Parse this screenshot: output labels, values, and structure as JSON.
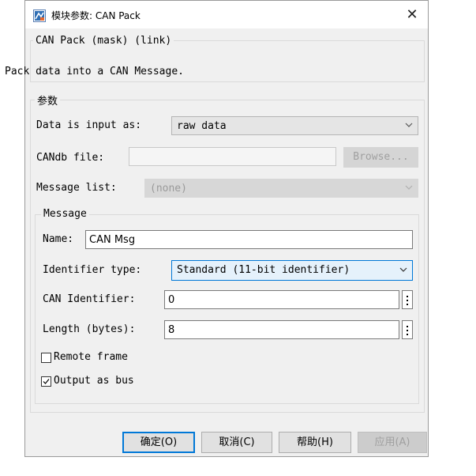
{
  "window": {
    "title": "模块参数: CAN Pack",
    "close_glyph": "✕"
  },
  "description": {
    "group_title": "CAN Pack (mask) (link)",
    "text": "Pack data into a CAN Message."
  },
  "params": {
    "group_title": "参数",
    "data_input": {
      "label": "Data is input as:",
      "value": "raw data"
    },
    "candb": {
      "label": "CANdb file:",
      "value": "",
      "browse_label": "Browse..."
    },
    "message_list": {
      "label": "Message list:",
      "value": "(none)"
    }
  },
  "message": {
    "group_title": "Message",
    "name": {
      "label": "Name:",
      "value": "CAN Msg"
    },
    "identifier_type": {
      "label": "Identifier type:",
      "value": "Standard (11-bit identifier)"
    },
    "can_identifier": {
      "label": "CAN Identifier:",
      "value": "0"
    },
    "length": {
      "label": "Length (bytes):",
      "value": "8"
    },
    "remote_frame": {
      "label": "Remote frame",
      "checked": false
    },
    "output_as_bus": {
      "label": "Output as bus",
      "checked": true
    }
  },
  "buttons": {
    "ok": "确定(O)",
    "cancel": "取消(C)",
    "help": "帮助(H)",
    "apply": "应用(A)"
  },
  "colors": {
    "accent": "#0078d7",
    "disabled_text": "#a0a0a0"
  }
}
